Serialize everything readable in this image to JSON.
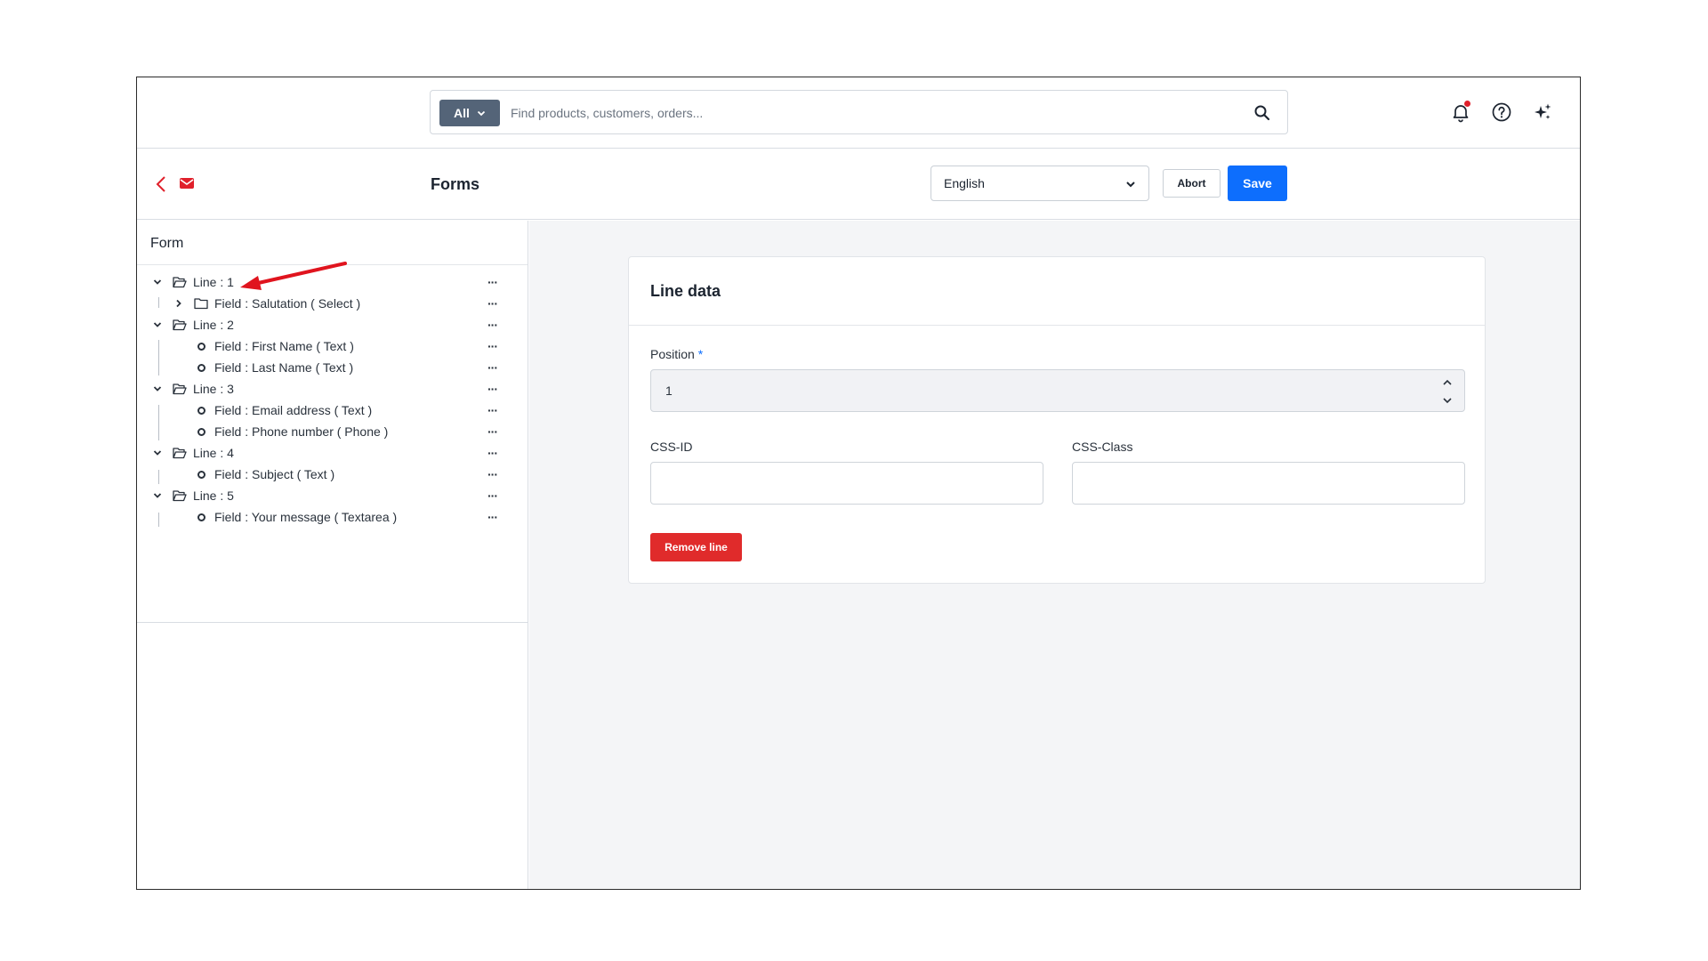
{
  "topbar": {
    "scope_label": "All",
    "search_placeholder": "Find products, customers, orders...",
    "icons": [
      "search-icon",
      "bell-icon",
      "help-icon",
      "sparkle-icon"
    ]
  },
  "header": {
    "title": "Forms",
    "language": "English",
    "abort_label": "Abort",
    "save_label": "Save"
  },
  "tree": {
    "heading": "Form",
    "more_label": "···",
    "rows": [
      {
        "label": "Line : 1",
        "type": "line"
      },
      {
        "label": "Field : Salutation ( Select )",
        "type": "folder-field"
      },
      {
        "label": "Line : 2",
        "type": "line"
      },
      {
        "label": "Field : First Name ( Text )",
        "type": "field"
      },
      {
        "label": "Field : Last Name ( Text )",
        "type": "field"
      },
      {
        "label": "Line : 3",
        "type": "line"
      },
      {
        "label": "Field : Email address ( Text )",
        "type": "field"
      },
      {
        "label": "Field : Phone number ( Phone )",
        "type": "field"
      },
      {
        "label": "Line : 4",
        "type": "line"
      },
      {
        "label": "Field : Subject ( Text )",
        "type": "field"
      },
      {
        "label": "Line : 5",
        "type": "line"
      },
      {
        "label": "Field : Your message ( Textarea )",
        "type": "field"
      }
    ]
  },
  "card": {
    "title": "Line data",
    "position_label": "Position",
    "required_mark": "*",
    "position_value": "1",
    "css_id_label": "CSS-ID",
    "css_id_value": "",
    "css_class_label": "CSS-Class",
    "css_class_value": "",
    "remove_label": "Remove line"
  },
  "colors": {
    "primary": "#0d6efd",
    "danger": "#e02b2b",
    "scope_button": "#546478",
    "brand_red": "#e0202b"
  }
}
